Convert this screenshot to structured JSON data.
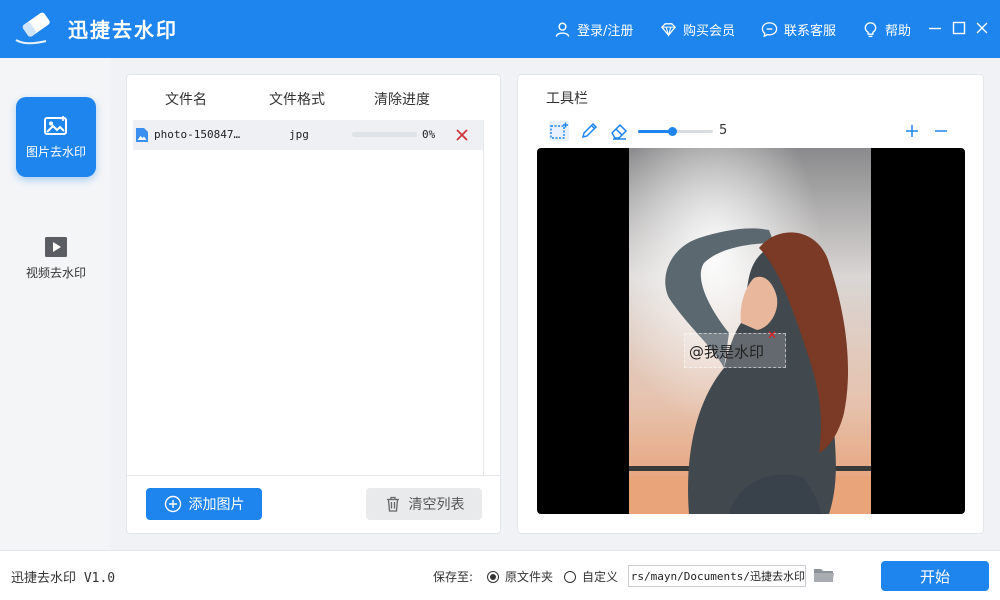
{
  "app": {
    "title": "迅捷去水印"
  },
  "header": {
    "login_label": "登录/注册",
    "vip_label": "购买会员",
    "service_label": "联系客服",
    "help_label": "帮助"
  },
  "sidebar": {
    "items": [
      {
        "label": "图片去水印",
        "active": true
      },
      {
        "label": "视频去水印",
        "active": false
      }
    ]
  },
  "file_list": {
    "columns": [
      "文件名",
      "文件格式",
      "清除进度"
    ],
    "rows": [
      {
        "name": "photo-150847…",
        "format": "jpg",
        "progress_text": "0%",
        "progress": 0
      }
    ],
    "add_label": "添加图片",
    "clear_label": "清空列表"
  },
  "preview": {
    "toolbar_title": "工具栏",
    "brush_size": "5",
    "brush_size_fraction": 0.45,
    "watermark_text": "@我是水印"
  },
  "footer": {
    "version": "迅捷去水印 V1.0",
    "save_to_label": "保存至:",
    "option_original": "原文件夹",
    "option_custom": "自定义",
    "selected_option": "original",
    "path": "C:/Users/mayn/Documents/迅捷去水印",
    "start_label": "开始"
  },
  "colors": {
    "accent": "#1e84ee",
    "danger": "#d0343c"
  }
}
